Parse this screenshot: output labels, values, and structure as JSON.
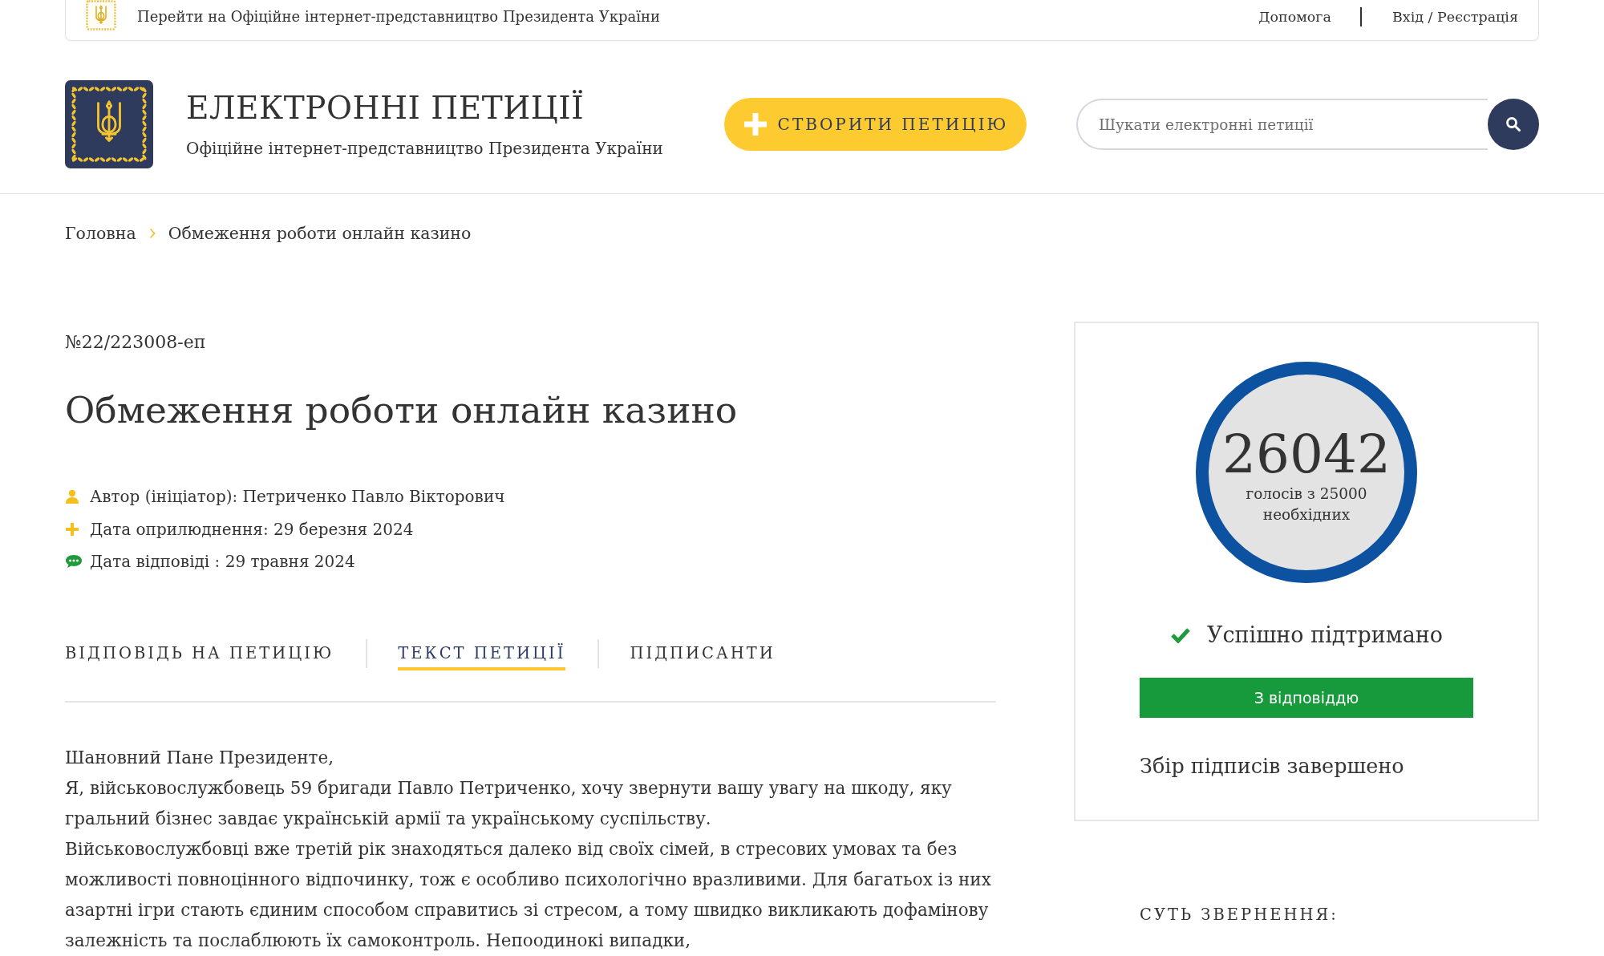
{
  "top_bar": {
    "site_link": "Перейти на Офіційне інтернет-представництво Президента України",
    "help": "Допомога",
    "login": "Вхід / Реєстрація"
  },
  "header": {
    "title": "ЕЛЕКТРОННІ ПЕТИЦІЇ",
    "subtitle": "Офіційне інтернет-представництво Президента України",
    "create_button": "СТВОРИТИ ПЕТИЦІЮ",
    "search": {
      "placeholder": "Шукати електронні петиції"
    }
  },
  "breadcrumbs": [
    {
      "label": "Головна"
    },
    {
      "label": "Обмеження роботи онлайн казино"
    }
  ],
  "petition": {
    "number": "№22/223008-еп",
    "title": "Обмеження роботи онлайн казино",
    "meta": [
      {
        "kind": "author",
        "text": "Автор (ініціатор): Петриченко Павло Вікторович"
      },
      {
        "kind": "published",
        "text": "Дата оприлюднення: 29 березня 2024"
      },
      {
        "kind": "answer",
        "text": "Дата відповіді : 29 травня 2024"
      }
    ],
    "tabs": [
      {
        "label": "ВІДПОВІДЬ НА ПЕТИЦІЮ",
        "selected": false
      },
      {
        "label": "ТЕКСТ ПЕТИЦІЇ",
        "selected": true
      },
      {
        "label": "ПІДПИСАНТИ",
        "selected": false
      }
    ],
    "text": [
      "Шановний Пане Президенте,",
      "Я, військовослужбовець 59 бригади Павло Петриченко, хочу звернути вашу увагу на шкоду, яку гральний бізнес завдає українській армії та українському суспільству.",
      "Військовослужбовці вже третій рік знаходяться далеко від своїх сімей, в стресових умовах та без можливості повноцінного відпочинку, тож є особливо психологічно вразливими. Для багатьох із них азартні ігри стають єдиним способом справитись зі стресом, а тому швидко викликають дофамінову залежність та послаблюють їх самоконтроль. Непоодинокі випадки,"
    ]
  },
  "votes_panel": {
    "count": "26042",
    "caption": "голосів з 25000 необхідних",
    "level": 1,
    "status": "Успішно підтримано",
    "answer_status": "З відповіддю",
    "collection": "Збір підписів завершено"
  },
  "summary": {
    "heading": "СУТЬ ЗВЕРНЕННЯ:"
  }
}
